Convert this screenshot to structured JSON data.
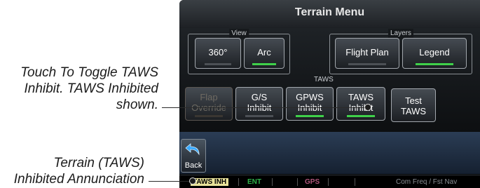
{
  "callouts": {
    "taws_toggle": [
      "Touch To Toggle TAWS",
      "Inhibit. TAWS Inhibited",
      "shown."
    ],
    "annunciation": [
      "Terrain (TAWS)",
      "Inhibited Annunciation"
    ]
  },
  "screen": {
    "title": "Terrain Menu",
    "view_group": {
      "label": "View",
      "buttons": [
        {
          "label": "360°",
          "active": false
        },
        {
          "label": "Arc",
          "active": true
        }
      ]
    },
    "layers_group": {
      "label": "Layers",
      "buttons": [
        {
          "label": "Flight Plan",
          "active": false
        },
        {
          "label": "Legend",
          "active": true
        }
      ]
    },
    "taws_group": {
      "label": "TAWS",
      "buttons": [
        {
          "line1": "Flap",
          "line2": "Override",
          "disabled": true,
          "active": false
        },
        {
          "line1": "G/S",
          "line2": "Inhibit",
          "disabled": false,
          "active": false
        },
        {
          "line1": "GPWS",
          "line2": "Inhibit",
          "disabled": false,
          "active": true
        },
        {
          "line1": "TAWS",
          "line2": "Inhibit",
          "disabled": false,
          "active": true
        }
      ]
    },
    "test_taws": {
      "line1": "Test",
      "line2": "TAWS"
    },
    "back": {
      "label": "Back",
      "icon": "back-arrow-icon"
    },
    "status_bar": {
      "taws_annunciation": "TAWS INH",
      "ent": "ENT",
      "gps": "GPS",
      "freq": "Com Freq / Fst Nav"
    },
    "colors": {
      "active_indicator": "#3fd04a",
      "taws_annunciation_bg": "#e9e29a",
      "ent_text": "#2fb34a",
      "gps_text": "#b0557a"
    }
  }
}
